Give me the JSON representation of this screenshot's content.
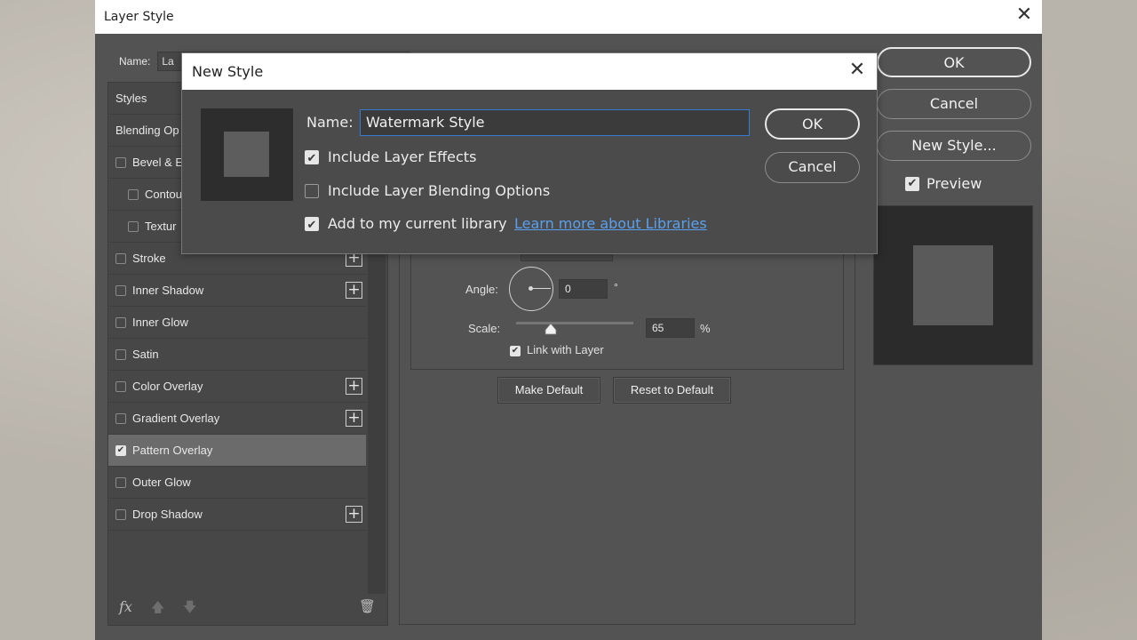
{
  "layer_style": {
    "title": "Layer Style",
    "close_glyph": "✕",
    "name_label": "Name:",
    "name_value": "La",
    "styles_header": "Styles",
    "blending_header": "Blending Op",
    "items": [
      {
        "label": "Bevel & E",
        "checked": false,
        "has_plus": false,
        "indent": false
      },
      {
        "label": "Contou",
        "checked": false,
        "has_plus": false,
        "indent": true
      },
      {
        "label": "Textur",
        "checked": false,
        "has_plus": false,
        "indent": true
      },
      {
        "label": "Stroke",
        "checked": false,
        "has_plus": true,
        "indent": false
      },
      {
        "label": "Inner Shadow",
        "checked": false,
        "has_plus": true,
        "indent": false
      },
      {
        "label": "Inner Glow",
        "checked": false,
        "has_plus": false,
        "indent": false
      },
      {
        "label": "Satin",
        "checked": false,
        "has_plus": false,
        "indent": false
      },
      {
        "label": "Color Overlay",
        "checked": false,
        "has_plus": true,
        "indent": false
      },
      {
        "label": "Gradient Overlay",
        "checked": false,
        "has_plus": true,
        "indent": false
      },
      {
        "label": "Pattern Overlay",
        "checked": true,
        "has_plus": false,
        "indent": false,
        "selected": true
      },
      {
        "label": "Outer Glow",
        "checked": false,
        "has_plus": false,
        "indent": false
      },
      {
        "label": "Drop Shadow",
        "checked": false,
        "has_plus": true,
        "indent": false
      }
    ],
    "footer": {
      "fx": "fx",
      "up": "🡅",
      "down": "🡇",
      "trash": "🗑"
    },
    "pattern": {
      "angle_label": "Angle:",
      "angle_value": "0",
      "degree_symbol": "°",
      "scale_label": "Scale:",
      "scale_value": "65",
      "scale_percent": 65,
      "percent_symbol": "%",
      "link_label": "Link with Layer",
      "link_checked": true,
      "make_default": "Make Default",
      "reset_default": "Reset to Default"
    },
    "buttons": {
      "ok": "OK",
      "cancel": "Cancel",
      "new_style": "New Style...",
      "preview": "Preview"
    }
  },
  "new_style": {
    "title": "New Style",
    "close_glyph": "✕",
    "name_label": "Name:",
    "name_value": "Watermark Style",
    "include_effects": "Include Layer Effects",
    "include_blending": "Include Layer Blending Options",
    "add_library": "Add to my current library",
    "learn_more": "Learn more about Libraries",
    "ok": "OK",
    "cancel": "Cancel",
    "check_glyph": "✔"
  },
  "colors": {
    "panel": "#535353",
    "accent_link": "#5aa0ef",
    "input_focus": "#3a7bd0"
  }
}
